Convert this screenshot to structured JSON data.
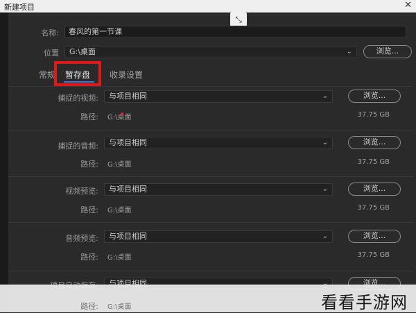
{
  "dialog": {
    "title": "新建项目",
    "close_icon": "close-icon"
  },
  "name_row": {
    "label": "名称:",
    "value": "春风的第一节课"
  },
  "location_row": {
    "label": "位置",
    "value": "G:\\桌面",
    "browse": "浏览..."
  },
  "tabs": [
    {
      "label": "常规",
      "active": false
    },
    {
      "label": "暂存盘",
      "active": true
    },
    {
      "label": "收录设置",
      "active": false
    }
  ],
  "scratch_disks": [
    {
      "label": "捕捉的视频:",
      "value": "与项目相同",
      "browse": "浏览...",
      "path_label": "路径:",
      "path": "G:\\桌面",
      "size": "37.75 GB"
    },
    {
      "label": "捕捉的音频:",
      "value": "与项目相同",
      "browse": "浏览...",
      "path_label": "路径:",
      "path": "G:\\桌面",
      "size": "37.75 GB"
    },
    {
      "label": "视频预览:",
      "value": "与项目相同",
      "browse": "浏览...",
      "path_label": "路径:",
      "path": "G:\\桌面",
      "size": "37.75 GB"
    },
    {
      "label": "音频预览:",
      "value": "与项目相同",
      "browse": "浏览...",
      "path_label": "路径:",
      "path": "G:\\桌面",
      "size": "37.75 GB"
    },
    {
      "label": "项目自动保存:",
      "value": "与项目相同",
      "browse": "浏览...",
      "path_label": "路径:",
      "path": "G:\\桌面"
    }
  ],
  "watermark": "看看手游网",
  "colors": {
    "highlight": "#e01818",
    "tab_underline": "#3d78d8"
  }
}
